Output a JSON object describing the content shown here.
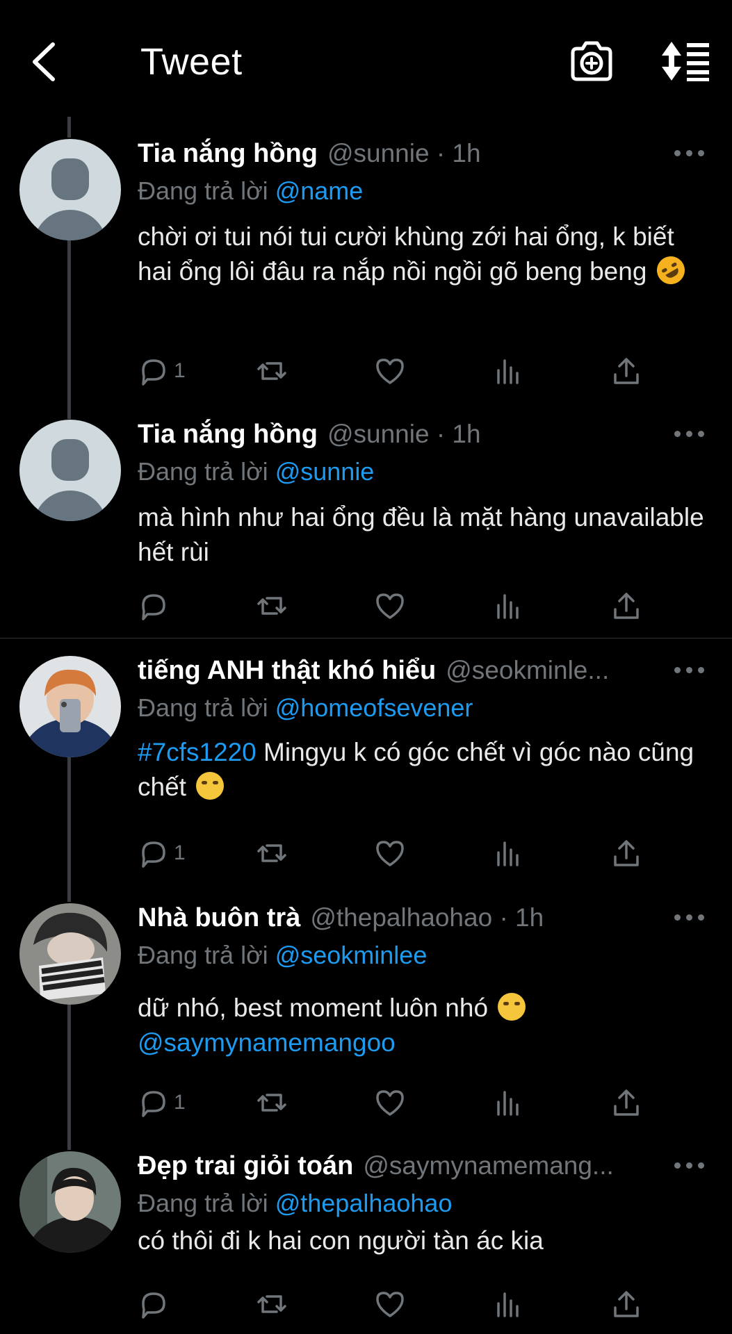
{
  "header": {
    "title": "Tweet"
  },
  "tweets": [
    {
      "name": "Tia nắng hồng",
      "handle": "@sunnie · 1h",
      "reply_prefix": "Đang trả lời",
      "reply_to": "@name",
      "text_parts": [
        "chời ơi tui nói tui cười khùng zới hai ổng, k biết hai ổng lôi đâu ra nắp nồi ngồi gõ beng beng"
      ],
      "reply_count": "1"
    },
    {
      "name": "Tia nắng hồng",
      "handle": "@sunnie · 1h",
      "reply_prefix": "Đang trả lời",
      "reply_to": "@sunnie",
      "text_parts": [
        "mà hình như hai ổng đều là mặt hàng unavailable hết rùi"
      ],
      "reply_count": ""
    },
    {
      "name": "tiếng ANH thật khó hiểu",
      "handle": "@seokminle...",
      "reply_prefix": "Đang trả lời",
      "reply_to": "@homeofsevener",
      "hashtag": "#7cfs1220",
      "text_parts": [
        " Mingyu k có góc chết vì góc nào cũng chết"
      ],
      "reply_count": "1"
    },
    {
      "name": "Nhà buôn trà",
      "handle": "@thepalhaohao · 1h",
      "reply_prefix": "Đang trả lời",
      "reply_to": "@seokminlee",
      "text_parts": [
        "dữ nhó, best moment luôn nhó"
      ],
      "link": "@saymynamemangoo",
      "reply_count": "1"
    },
    {
      "name": "Đẹp trai giỏi toán",
      "handle": "@saymynamemang...",
      "reply_prefix": "Đang trả lời",
      "reply_to": "@thepalhaohao",
      "text_parts": [
        "có thôi đi k hai con người tàn ác kia"
      ],
      "reply_count": ""
    }
  ],
  "icons": {
    "back": "back-arrow-icon",
    "camera": "camera-plus-icon",
    "sort": "sort-icon",
    "reply": "reply-icon",
    "retweet": "retweet-icon",
    "like": "heart-icon",
    "views": "views-icon",
    "share": "share-icon"
  },
  "colors": {
    "background": "#000000",
    "text": "#e7e9ea",
    "secondary": "#71767b",
    "accent": "#1d9bf0"
  }
}
